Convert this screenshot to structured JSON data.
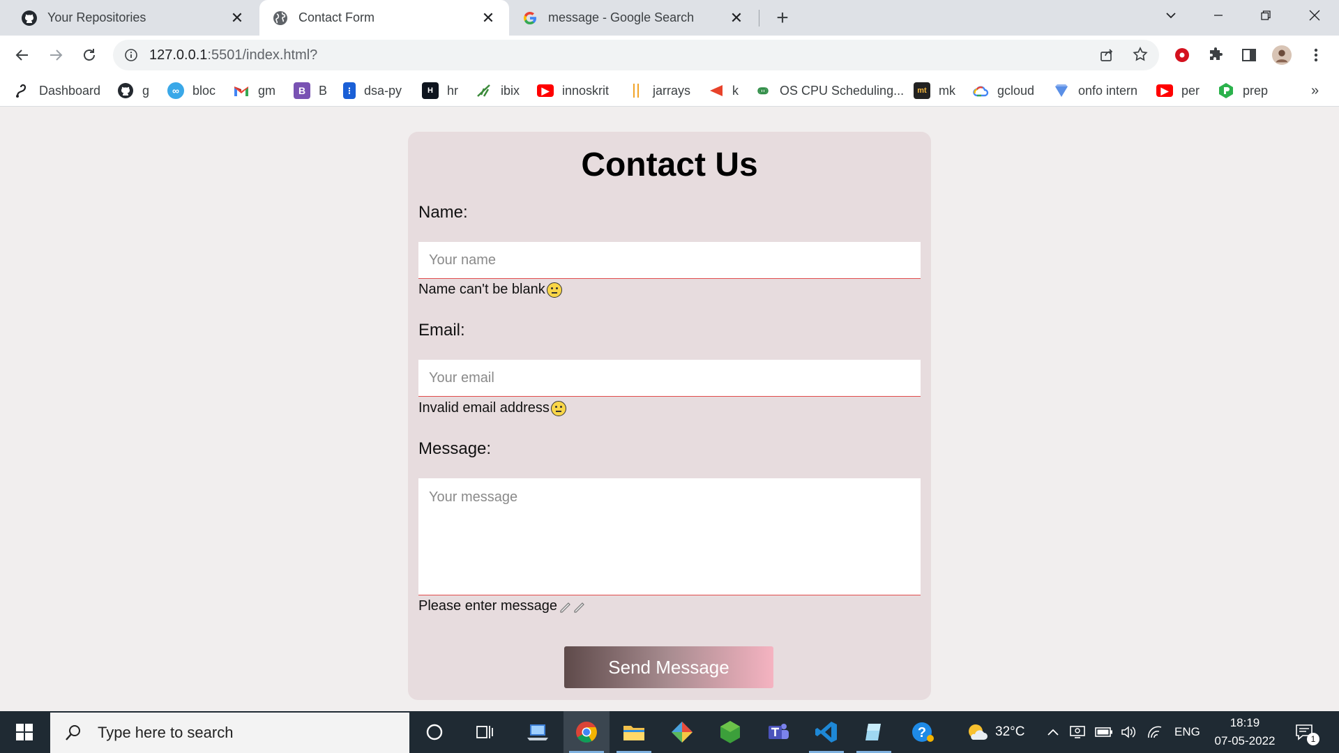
{
  "browser": {
    "tabs": [
      {
        "title": "Your Repositories",
        "icon": "github-icon",
        "active": false
      },
      {
        "title": "Contact Form",
        "icon": "globe-icon",
        "active": true
      },
      {
        "title": "message - Google Search",
        "icon": "google-icon",
        "active": false
      }
    ],
    "url": {
      "host": "127.0.0.1",
      "path": ":5501/index.html?"
    },
    "bookmarks": [
      {
        "label": "Dashboard",
        "icon": "dashboard-icon"
      },
      {
        "label": "g",
        "icon": "github-icon"
      },
      {
        "label": "bloc",
        "icon": "bloc-icon"
      },
      {
        "label": "gm",
        "icon": "gmail-icon"
      },
      {
        "label": "B",
        "icon": "bootstrap-icon"
      },
      {
        "label": "dsa-py",
        "icon": "dsa-icon"
      },
      {
        "label": "hr",
        "icon": "hackerrank-icon"
      },
      {
        "label": "ibix",
        "icon": "ibix-icon"
      },
      {
        "label": "innoskrit",
        "icon": "youtube-icon"
      },
      {
        "label": "jarrays",
        "icon": "jarrays-icon"
      },
      {
        "label": "k",
        "icon": "k-icon"
      },
      {
        "label": "OS CPU Scheduling...",
        "icon": "gfg-icon"
      },
      {
        "label": "mk",
        "icon": "mt-icon"
      },
      {
        "label": "gcloud",
        "icon": "gcloud-icon"
      },
      {
        "label": "onfo intern",
        "icon": "onfo-icon"
      },
      {
        "label": "per",
        "icon": "youtube-icon"
      },
      {
        "label": "prep",
        "icon": "prep-icon"
      }
    ],
    "more_bookmarks": "»"
  },
  "form": {
    "title": "Contact Us",
    "name_label": "Name:",
    "name_placeholder": "Your name",
    "name_error": "Name can't be blank",
    "email_label": "Email:",
    "email_placeholder": "Your email",
    "email_error": "Invalid email address",
    "message_label": "Message:",
    "message_placeholder": "Your message",
    "message_error": "Please enter message",
    "submit_label": "Send Message"
  },
  "taskbar": {
    "search_placeholder": "Type here to search",
    "weather": "32°C",
    "language": "ENG",
    "time": "18:19",
    "date": "07-05-2022",
    "notifications": "1"
  }
}
